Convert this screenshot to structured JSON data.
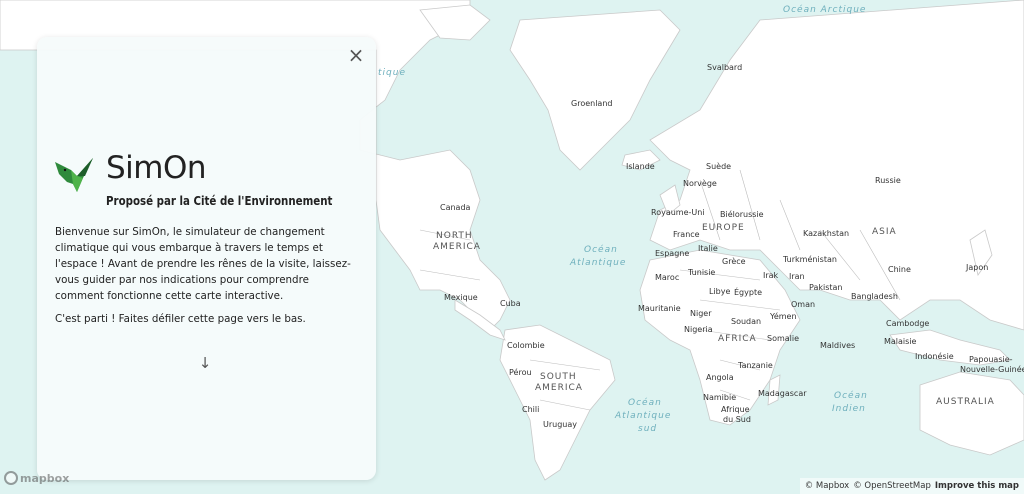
{
  "map": {
    "colors": {
      "water": "#def3f1",
      "land": "#ffffff",
      "border": "#c9c9c9"
    },
    "labels": {
      "ocean_arctique": "Océan Arctique",
      "ocean_atlantique_1": "Océan",
      "ocean_atlantique_2": "Atlantique",
      "ocean_atlantique_sud_1": "Océan",
      "ocean_atlantique_sud_2": "Atlantique",
      "ocean_atlantique_sud_3": "sud",
      "ocean_indien_1": "Océan",
      "ocean_indien_2": "Indien",
      "ocean_tique": "tique",
      "na_1": "NORTH",
      "na_2": "AMERICA",
      "sa_1": "SOUTH",
      "sa_2": "AMERICA",
      "europe": "EUROPE",
      "asia": "ASIA",
      "africa": "AFRICA",
      "australia": "AUSTRALIA",
      "svalbard": "Svalbard",
      "groenland": "Groenland",
      "islande": "Islande",
      "suede": "Suède",
      "norvege": "Norvège",
      "royaume_uni": "Royaume-Uni",
      "bielorussie": "Biélorussie",
      "france": "France",
      "italie": "Italie",
      "espagne": "Espagne",
      "grece": "Grèce",
      "tunisie": "Tunisie",
      "maroc": "Maroc",
      "libye": "Libye",
      "egypte": "Égypte",
      "mauritanie": "Mauritanie",
      "niger": "Niger",
      "nigeria": "Nigeria",
      "soudan": "Soudan",
      "yemen": "Yémen",
      "oman": "Oman",
      "irak": "Irak",
      "iran": "Iran",
      "pakistan": "Pakistan",
      "turkmenistan": "Turkménistan",
      "kazakhstan": "Kazakhstan",
      "russie": "Russie",
      "chine": "Chine",
      "japon": "Japon",
      "bangladesh": "Bangladesh",
      "cambodge": "Cambodge",
      "malaisie": "Malaisie",
      "indonesie": "Indonésie",
      "papouasie_1": "Papouasie-",
      "papouasie_2": "Nouvelle-Guinée",
      "maldives": "Maldives",
      "somalie": "Somalie",
      "tanzanie": "Tanzanie",
      "angola": "Angola",
      "namibie": "Namibie",
      "madagascar": "Madagascar",
      "afrique_sud_1": "Afrique",
      "afrique_sud_2": "du Sud",
      "canada": "Canada",
      "mexique": "Mexique",
      "cuba": "Cuba",
      "colombie": "Colombie",
      "perou": "Pérou",
      "chili": "Chili",
      "uruguay": "Uruguay"
    }
  },
  "panel": {
    "close_symbol": "×",
    "logo_icon": "hummingbird-logo",
    "title": "SimOn",
    "subtitle": "Proposé par la Cité de l'Environnement",
    "intro": "Bienvenue sur SimOn, le simulateur de changement climatique qui vous embarque à travers le temps et l'espace ! Avant de prendre les rênes de la visite, laissez-vous guider par nos indications pour comprendre comment fonctionne cette carte interactive.",
    "hint": "C'est parti ! Faites défiler cette page vers le bas.",
    "scroll_symbol": "↓"
  },
  "footer": {
    "mapbox_logo": "mapbox",
    "attrib_mapbox": "© Mapbox",
    "attrib_osm": "© OpenStreetMap",
    "improve": "Improve this map"
  }
}
